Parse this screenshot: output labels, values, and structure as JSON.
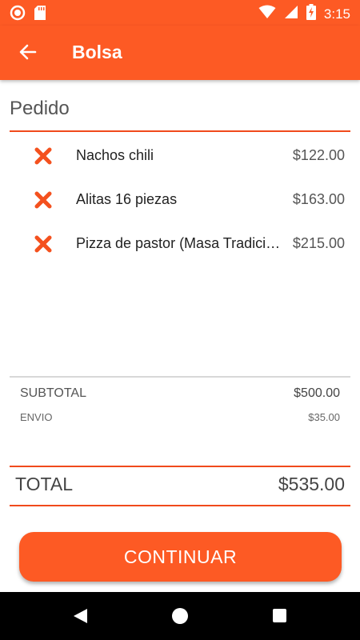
{
  "status_bar": {
    "time": "3:15",
    "left_icons": [
      "record-icon",
      "sd-card-icon"
    ],
    "right_icons": [
      "wifi-icon",
      "signal-icon",
      "battery-charging-icon"
    ]
  },
  "app_bar": {
    "title": "Bolsa",
    "back_icon": "arrow-left-icon"
  },
  "order": {
    "section_title": "Pedido",
    "remove_icon": "close-icon",
    "items": [
      {
        "name": "Nachos chili",
        "price": "$122.00"
      },
      {
        "name": "Alitas 16 piezas",
        "price": "$163.00"
      },
      {
        "name": "Pizza de pastor (Masa Tradicional)",
        "price": "$215.00"
      }
    ]
  },
  "summary": {
    "subtotal_label": "SUBTOTAL",
    "subtotal_value": "$500.00",
    "envio_label": "ENVIO",
    "envio_value": "$35.00",
    "total_label": "TOTAL",
    "total_value": "$535.00"
  },
  "actions": {
    "continue_label": "CONTINUAR"
  },
  "nav_bar": {
    "icons": [
      "nav-back-icon",
      "nav-home-icon",
      "nav-recents-icon"
    ]
  },
  "colors": {
    "accent": "#fd5a24",
    "divider_accent": "#f04a1c",
    "divider_gray": "#d8d8d8",
    "nav_background": "#000000"
  }
}
